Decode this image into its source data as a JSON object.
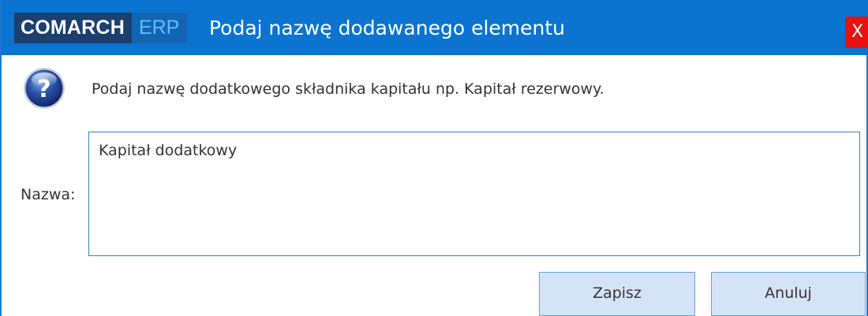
{
  "titlebar": {
    "brand_primary": "COMARCH",
    "brand_secondary": "ERP",
    "title": "Podaj nazwę dodawanego elementu",
    "close_label": "X"
  },
  "message": {
    "icon": "question-icon",
    "text": "Podaj nazwę dodatkowego składnika kapitału np. Kapitał rezerwowy."
  },
  "form": {
    "name_label": "Nazwa:",
    "name_value": "Kapitał dodatkowy"
  },
  "buttons": {
    "save_label": "Zapisz",
    "cancel_label": "Anuluj"
  },
  "colors": {
    "titlebar": "#0a74d0",
    "brand_dark": "#1b3f6e",
    "brand_erp_bg": "#1464b4",
    "brand_erp_text": "#5bc3ff",
    "close": "#e81010",
    "button_bg": "#d4e4f6",
    "input_border": "#3c7fd4"
  }
}
